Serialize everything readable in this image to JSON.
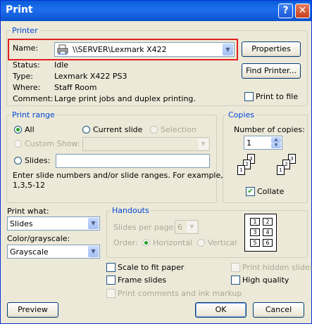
{
  "window": {
    "title": "Print",
    "help_glyph": "?",
    "close_glyph": "✕"
  },
  "printer": {
    "group_label": "Printer",
    "name_label": "Name:",
    "name_value": "\\\\SERVER\\Lexmark X422",
    "status_label": "Status:",
    "status_value": "Idle",
    "type_label": "Type:",
    "type_value": "Lexmark X422 PS3",
    "where_label": "Where:",
    "where_value": "Staff Room",
    "comment_label": "Comment:",
    "comment_value": "Large print jobs and duplex printing.",
    "properties_label": "Properties",
    "find_printer_label": "Find Printer...",
    "print_to_file_label": "Print to file",
    "print_to_file_checked": false
  },
  "print_range": {
    "group_label": "Print range",
    "all_label": "All",
    "current_slide_label": "Current slide",
    "selection_label": "Selection",
    "custom_show_label": "Custom Show:",
    "slides_label": "Slides:",
    "slides_value": "",
    "hint": "Enter slide numbers and/or slide ranges. For example,",
    "hint_example": "1,3,5-12",
    "selected": "All"
  },
  "copies": {
    "group_label": "Copies",
    "number_label": "Number of copies:",
    "number_value": "1",
    "collate_label": "Collate",
    "collate_checked": true
  },
  "print_what": {
    "label": "Print what:",
    "value": "Slides"
  },
  "color": {
    "label": "Color/grayscale:",
    "value": "Grayscale"
  },
  "handouts": {
    "group_label": "Handouts",
    "slides_per_page_label": "Slides per page:",
    "slides_per_page_value": "6",
    "order_label": "Order:",
    "horizontal_label": "Horizontal",
    "vertical_label": "Vertical",
    "order_selected": "Horizontal",
    "preview_cells": [
      "1",
      "2",
      "3",
      "4",
      "5",
      "6"
    ]
  },
  "options": {
    "scale_to_fit": "Scale to fit paper",
    "frame_slides": "Frame slides",
    "print_comments": "Print comments and ink markup",
    "print_hidden": "Print hidden slides",
    "high_quality": "High quality"
  },
  "buttons": {
    "preview": "Preview",
    "ok": "OK",
    "cancel": "Cancel"
  }
}
